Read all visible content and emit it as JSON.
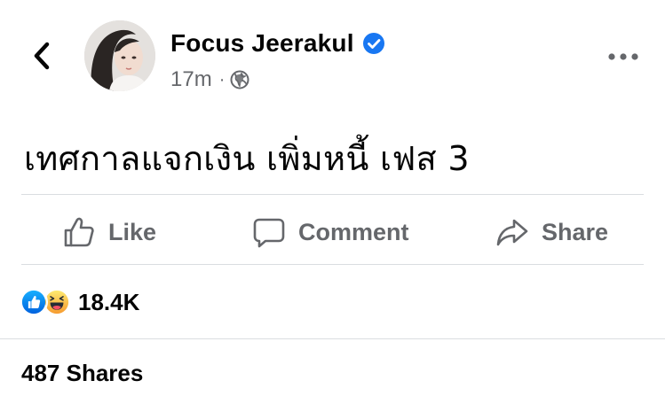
{
  "post": {
    "author": "Focus Jeerakul",
    "timestamp": "17m",
    "separator": "·",
    "audience_icon": "globe-icon",
    "text": "เทศกาลแจกเงิน เพิ่มหนี้ เฟส 3"
  },
  "actions": {
    "like": "Like",
    "comment": "Comment",
    "share": "Share"
  },
  "stats": {
    "reactions_count": "18.4K",
    "reaction_types": [
      "like",
      "haha"
    ],
    "shares": "487 Shares"
  },
  "colors": {
    "primary_text": "#050505",
    "secondary_text": "#65676b",
    "verified_blue": "#1877f2",
    "divider": "#dadde1"
  }
}
